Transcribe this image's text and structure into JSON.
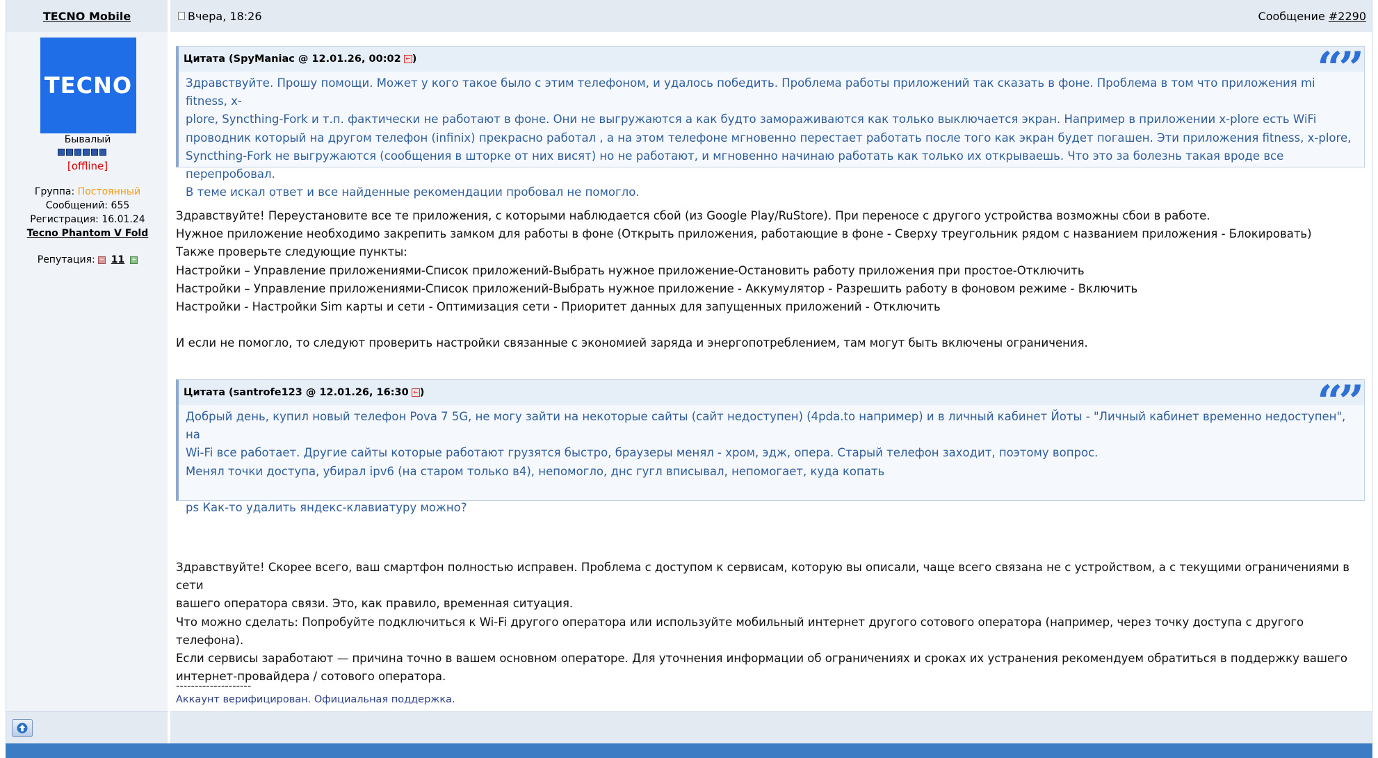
{
  "header": {
    "username": "TECNO Mobile",
    "date": "Вчера, 18:26",
    "message_label": "Сообщение",
    "message_number": "#2290"
  },
  "user": {
    "avatar_text": "TECNO",
    "rank": "Бывалый",
    "pips": 6,
    "status": "[offline]",
    "group_label": "Группа:",
    "group_value": "Постоянный",
    "messages": "Сообщений: 655",
    "registration": "Регистрация: 16.01.24",
    "device": "Tecno Phantom V Fold",
    "reputation_label": "Репутация:",
    "reputation_value": "11",
    "rep_minus": "−",
    "rep_plus": "+"
  },
  "post": {
    "quote1": {
      "header": "Цитата (SpyManiac @ 12.01.26, 00:02",
      "header_end": ")",
      "lines": [
        "Здравствуйте. Прошу помощи. Может у кого такое было с этим телефоном, и удалось победить. Проблема работы приложений так сказать в фоне. Проблема в том что приложения mi fitness, x-",
        "plore, Syncthing-Fork и т.п. фактически не работают в фоне. Они не выгружаются а как будто замораживаются как только выключается экран. Например в приложении x-plore есть WiFi",
        "проводник который на другом телефон (infinix) прекрасно работал , а на этом телефоне мгновенно перестает работать после того как экран будет погашен. Эти приложения fitness, x-plore,",
        "Syncthing-Fork не выгружаются (сообщения в шторке от них висят) но не работают, и мгновенно начинаю работать как только их открываешь. Что это за болезнь такая вроде все перепробовал.",
        "В теме искал ответ и все найденные рекомендации пробовал не помогло."
      ]
    },
    "reply1": [
      "Здравствуйте! Переустановите все те приложения, с которыми наблюдается сбой (из Google Play/RuStore). При переносе с другого устройства возможны сбои в работе.",
      "Нужное приложение необходимо закрепить замком для работы в фоне (Открыть приложения, работающие в фоне - Сверху треугольник рядом с названием приложения - Блокировать)",
      "Также проверьте следующие пункты:",
      "Настройки – Управление приложениями-Список приложений-Выбрать нужное приложение-Остановить работу приложения при простое-Отключить",
      "Настройки – Управление приложениями-Список приложений-Выбрать нужное приложение - Аккумулятор - Разрешить работу в фоновом режиме - Включить",
      "Настройки - Настройки Sim карты и сети - Оптимизация сети - Приоритет данных для запущенных приложений - Отключить",
      "",
      "И если не помогло, то следуют проверить настройки связанные с экономией заряда и энергопотреблением, там могут быть включены ограничения."
    ],
    "quote2": {
      "header": "Цитата (santrofe123 @ 12.01.26, 16:30",
      "header_end": ")",
      "lines": [
        "Добрый день, купил новый телефон Pova 7 5G, не могу зайти на некоторые сайты (сайт недоступен) (4pda.to например) и в личный кабинет Йоты - \"Личный кабинет временно недоступен\", на",
        "Wi-Fi все работает. Другие сайты которые работают грузятся быстро, браузеры менял - хром, эдж, опера. Старый телефон заходит, поэтому вопрос.",
        "Менял точки доступа, убирал ipv6 (на старом только в4), непомогло, днс гугл вписывал, непомогает, куда копать",
        "",
        "ps Как-то удалить яндекс-клавиатуру можно?"
      ]
    },
    "reply2": [
      "Здравствуйте! Скорее всего, ваш смартфон полностью исправен. Проблема с доступом к сервисам, которую вы описали, чаще всего связана не с устройством, а с текущими ограничениями в сети",
      "вашего оператора связи. Это, как правило, временная ситуация.",
      "Что можно сделать: Попробуйте подключиться к Wi-Fi другого оператора или используйте мобильный интернет другого сотового оператора (например, через точку доступа с другого телефона).",
      "Если сервисы заработают — причина точно в вашем основном операторе. Для уточнения информации об ограничениях и сроках их устранения рекомендуем обратиться в поддержку вашего",
      "интернет-провайдера / сотового оператора."
    ],
    "signature_line": "--------------------",
    "signature": "Аккаунт верифицирован. Официальная поддержка."
  },
  "colors": {
    "header_bg": "#e4eaf2",
    "quote_text": "#2f5e9c",
    "group": "#f39c12",
    "offline": "#e00000",
    "bottom_bar": "#3b7cc4"
  },
  "icons": {
    "quote_mark": "quote-mark-icon",
    "back": "back-arrow-icon",
    "up": "arrow-up-icon",
    "doc": "document-icon"
  }
}
